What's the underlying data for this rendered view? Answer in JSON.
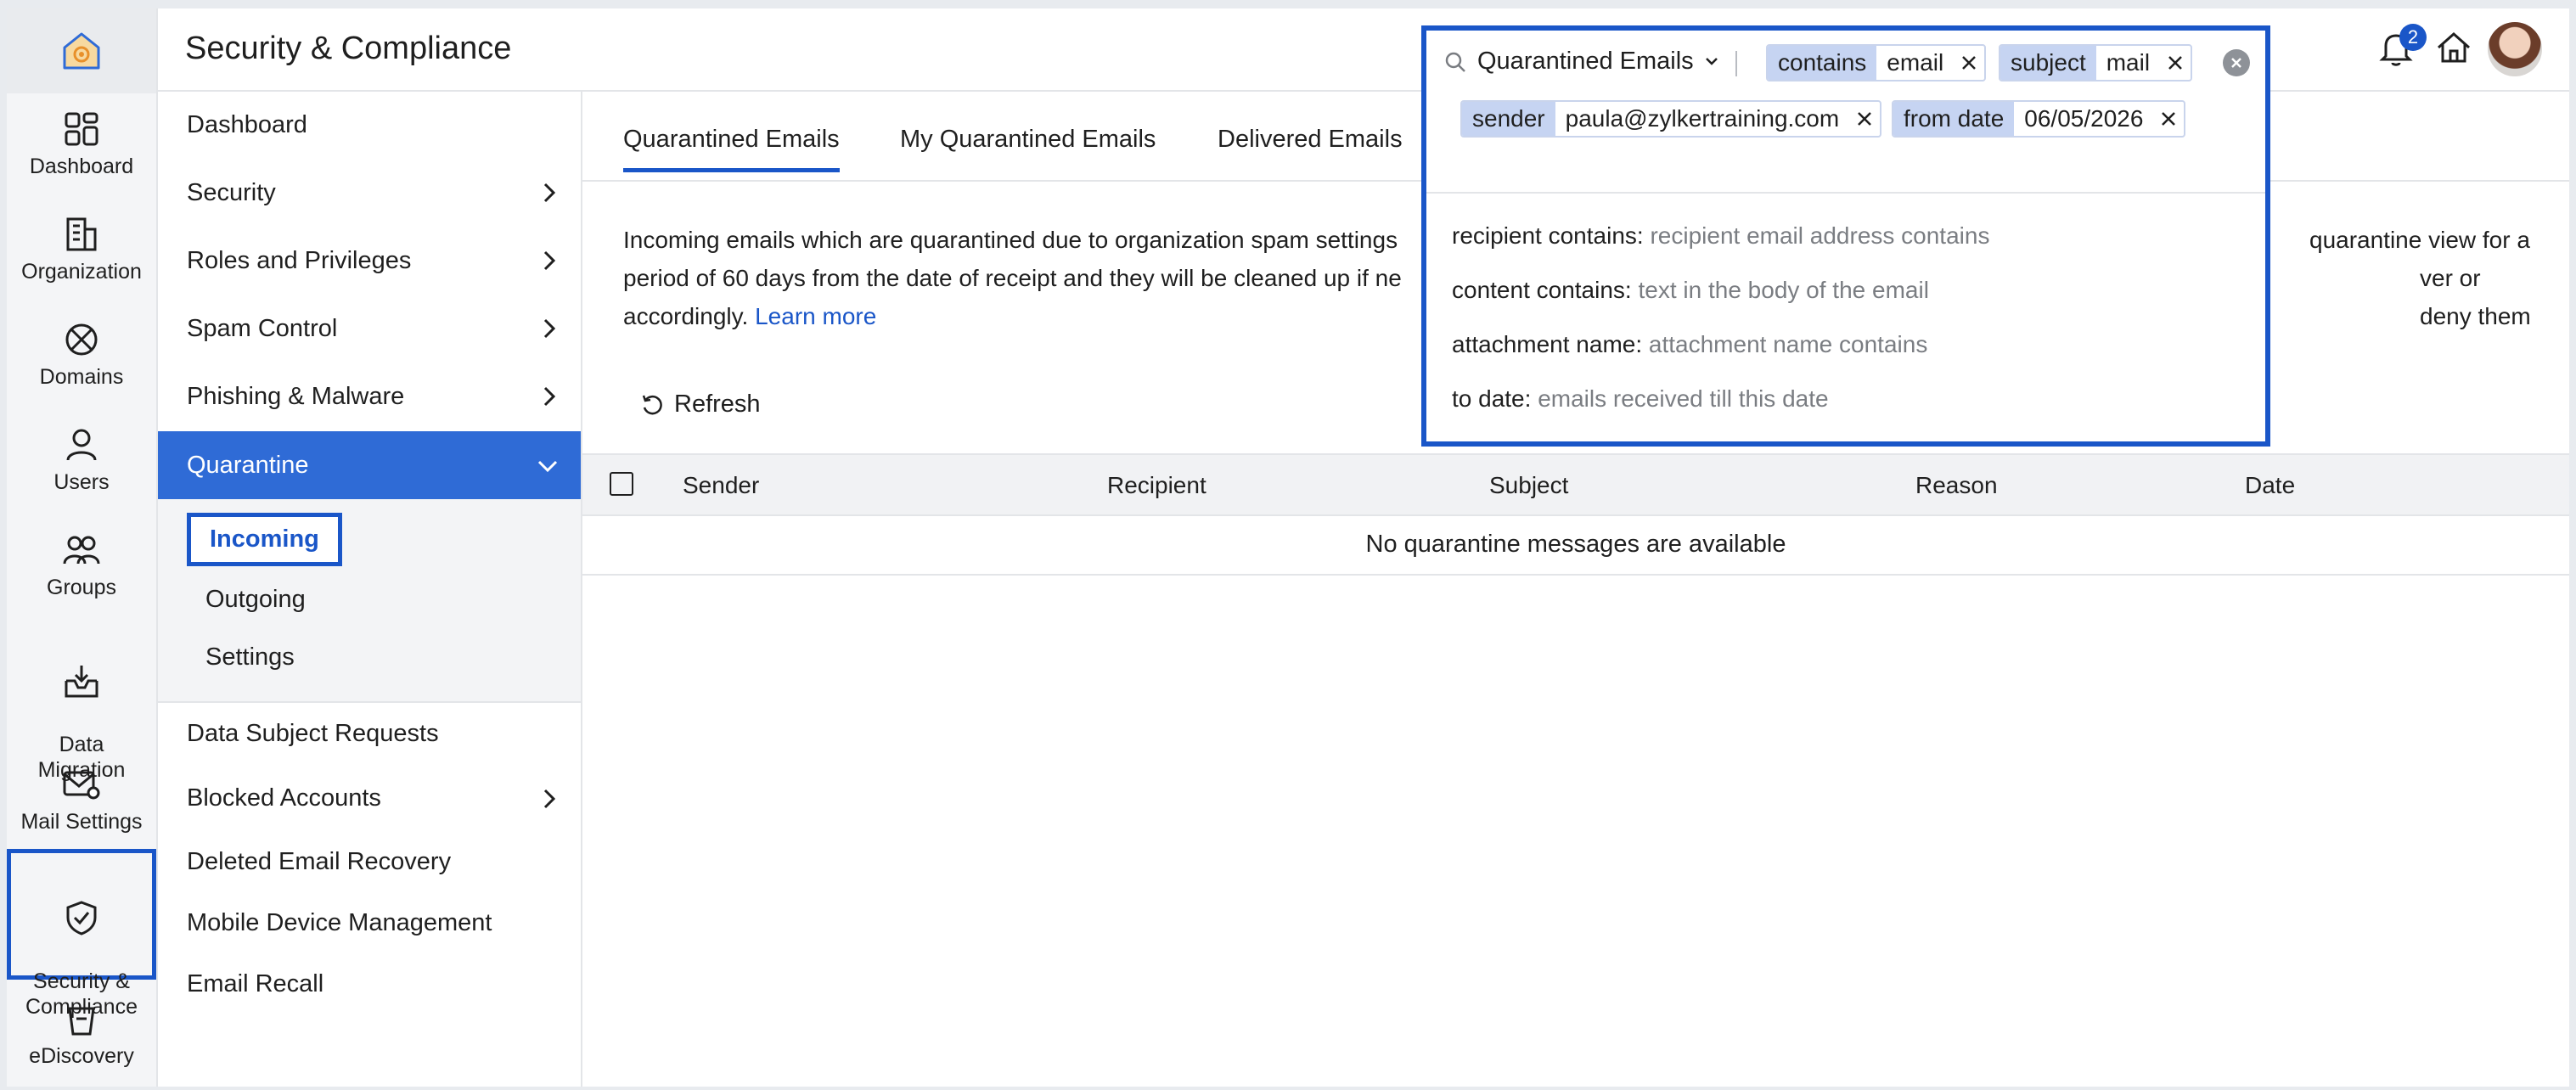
{
  "header": {
    "title": "Security & Compliance",
    "notification_count": "2"
  },
  "rail": {
    "items": [
      {
        "label": "Dashboard",
        "icon": "dashboard-icon"
      },
      {
        "label": "Organization",
        "icon": "organization-icon"
      },
      {
        "label": "Domains",
        "icon": "domains-icon"
      },
      {
        "label": "Users",
        "icon": "user-icon"
      },
      {
        "label": "Groups",
        "icon": "groups-icon"
      },
      {
        "label": "Data\nMigration",
        "icon": "data-migration-icon"
      },
      {
        "label": "Mail Settings",
        "icon": "mail-settings-icon"
      },
      {
        "label": "Security &\nCompliance",
        "icon": "shield-check-icon"
      },
      {
        "label": "eDiscovery",
        "icon": "ediscovery-icon"
      }
    ]
  },
  "nav": {
    "items": [
      {
        "label": "Dashboard",
        "chevron": false
      },
      {
        "label": "Security",
        "chevron": true
      },
      {
        "label": "Roles and Privileges",
        "chevron": true
      },
      {
        "label": "Spam Control",
        "chevron": true
      },
      {
        "label": "Phishing & Malware",
        "chevron": true
      },
      {
        "label": "Quarantine",
        "chevron": true,
        "expanded": true
      },
      {
        "label": "Data Subject Requests",
        "chevron": false
      },
      {
        "label": "Blocked Accounts",
        "chevron": true
      },
      {
        "label": "Deleted Email Recovery",
        "chevron": false
      },
      {
        "label": "Mobile Device Management",
        "chevron": false
      },
      {
        "label": "Email Recall",
        "chevron": false
      }
    ],
    "quarantine_sub": [
      "Incoming",
      "Outgoing",
      "Settings"
    ]
  },
  "tabs": [
    "Quarantined Emails",
    "My Quarantined Emails",
    "Delivered Emails"
  ],
  "description": {
    "line1": "Incoming emails which are quarantined due to organization spam settings",
    "line1_end": "quarantine view for a",
    "line2": "period of 60 days from the date of receipt and they will be cleaned up if ne",
    "line2_end": "ver or deny them",
    "line3": "accordingly.",
    "learn_more": "Learn more"
  },
  "toolbar": {
    "refresh": "Refresh"
  },
  "table": {
    "columns": [
      "Sender",
      "Recipient",
      "Subject",
      "Reason",
      "Date"
    ],
    "empty_message": "No quarantine messages are available"
  },
  "search": {
    "scope": "Quarantined Emails",
    "chips": [
      {
        "key": "contains",
        "value": "email"
      },
      {
        "key": "subject",
        "value": "mail"
      },
      {
        "key": "sender",
        "value": "paula@zylkertraining.com"
      },
      {
        "key": "from date",
        "value": "06/05/2026"
      }
    ],
    "suggestions": [
      {
        "key": "recipient contains:",
        "hint": "recipient email address contains"
      },
      {
        "key": "content contains:",
        "hint": "text in the body of the email"
      },
      {
        "key": "attachment name:",
        "hint": "attachment name contains"
      },
      {
        "key": "to date:",
        "hint": "emails received till this date"
      }
    ]
  },
  "colors": {
    "accent": "#1a56c8",
    "active_nav": "#2f6bd6",
    "chip_key": "#c6d4f2"
  }
}
